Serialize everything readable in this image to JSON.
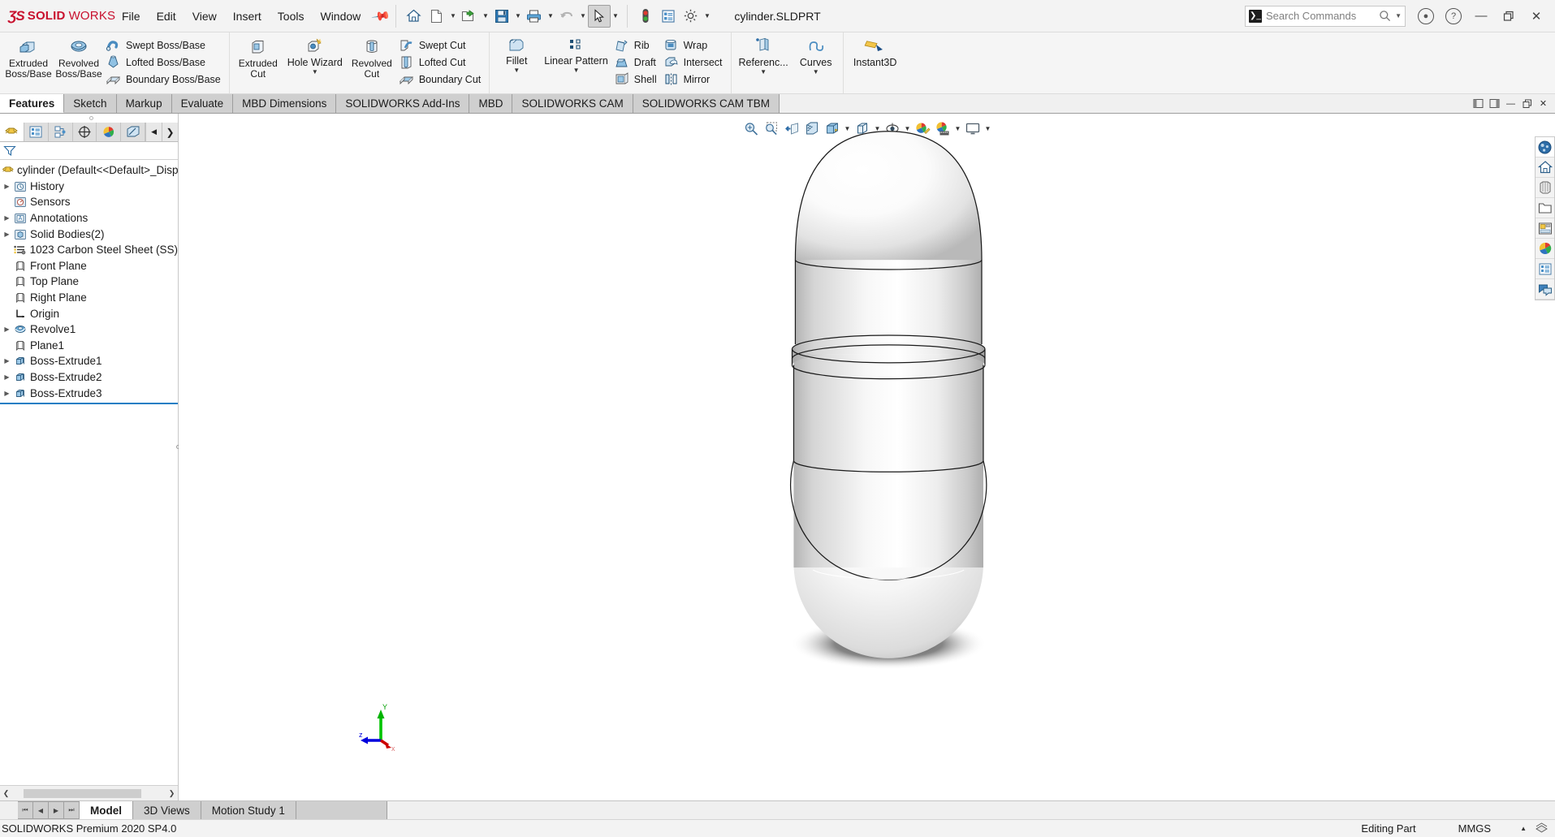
{
  "app": {
    "brand_ds": "ƷS",
    "brand_solid": "SOLID",
    "brand_works": "WORKS",
    "document_title": "cylinder.SLDPRT",
    "accent_red": "#c8102e",
    "accent_blue": "#1f7ec4"
  },
  "menu": {
    "items": [
      {
        "label": "File"
      },
      {
        "label": "Edit"
      },
      {
        "label": "View"
      },
      {
        "label": "Insert"
      },
      {
        "label": "Tools"
      },
      {
        "label": "Window"
      }
    ],
    "pin_icon": "pushpin-icon"
  },
  "quick_access": {
    "buttons": [
      {
        "icon": "home-icon",
        "has_caret": false
      },
      {
        "icon": "new-document-icon",
        "has_caret": true
      },
      {
        "icon": "open-folder-icon",
        "has_caret": true
      },
      {
        "icon": "save-icon",
        "has_caret": true
      },
      {
        "icon": "print-icon",
        "has_caret": true
      },
      {
        "icon": "undo-icon",
        "has_caret": true
      },
      {
        "icon": "select-cursor-icon",
        "has_caret": true
      },
      {
        "icon": "rebuild-traffic-light-icon",
        "has_caret": false
      },
      {
        "icon": "file-properties-icon",
        "has_caret": false
      },
      {
        "icon": "options-gear-icon",
        "has_caret": true
      }
    ]
  },
  "search": {
    "placeholder": "Search Commands",
    "icon": "search-commands-icon",
    "magnifier": "search-icon",
    "caret": "chevron-down-icon"
  },
  "window_controls": {
    "account": "account-icon",
    "help": "help-icon",
    "minimize": "minimize-icon",
    "restore": "restore-icon",
    "close": "close-icon"
  },
  "ribbon": {
    "groups": [
      {
        "name": "boss-base",
        "big": [
          {
            "label": "Extruded\nBoss/Base",
            "icon": "extruded-boss-base-icon",
            "caret": true
          },
          {
            "label": "Revolved\nBoss/Base",
            "icon": "revolved-boss-base-icon",
            "caret": true
          }
        ],
        "small": [
          {
            "label": "Swept Boss/Base",
            "icon": "swept-boss-base-icon"
          },
          {
            "label": "Lofted Boss/Base",
            "icon": "lofted-boss-base-icon"
          },
          {
            "label": "Boundary Boss/Base",
            "icon": "boundary-boss-base-icon"
          }
        ]
      },
      {
        "name": "cut",
        "big": [
          {
            "label": "Extruded\nCut",
            "icon": "extruded-cut-icon",
            "caret": true
          },
          {
            "label": "Hole Wizard",
            "icon": "hole-wizard-icon",
            "caret": true
          },
          {
            "label": "Revolved\nCut",
            "icon": "revolved-cut-icon",
            "caret": false
          }
        ],
        "small": [
          {
            "label": "Swept Cut",
            "icon": "swept-cut-icon"
          },
          {
            "label": "Lofted Cut",
            "icon": "lofted-cut-icon"
          },
          {
            "label": "Boundary Cut",
            "icon": "boundary-cut-icon"
          }
        ]
      },
      {
        "name": "features",
        "big": [
          {
            "label": "Fillet",
            "icon": "fillet-icon",
            "caret": true
          },
          {
            "label": "Linear Pattern",
            "icon": "linear-pattern-icon",
            "caret": true
          }
        ],
        "small": [
          {
            "label": "Rib",
            "icon": "rib-icon"
          },
          {
            "label": "Draft",
            "icon": "draft-icon"
          },
          {
            "label": "Shell",
            "icon": "shell-icon"
          }
        ],
        "small2": [
          {
            "label": "Wrap",
            "icon": "wrap-icon"
          },
          {
            "label": "Intersect",
            "icon": "intersect-icon"
          },
          {
            "label": "Mirror",
            "icon": "mirror-icon"
          }
        ]
      },
      {
        "name": "reference",
        "big": [
          {
            "label": "Referenc...",
            "icon": "reference-geometry-icon",
            "caret": true
          },
          {
            "label": "Curves",
            "icon": "curves-icon",
            "caret": true
          }
        ]
      },
      {
        "name": "instant3d",
        "big": [
          {
            "label": "Instant3D",
            "icon": "instant3d-icon",
            "caret": false
          }
        ]
      }
    ]
  },
  "command_tabs": {
    "items": [
      {
        "label": "Features",
        "active": true
      },
      {
        "label": "Sketch",
        "active": false
      },
      {
        "label": "Markup",
        "active": false
      },
      {
        "label": "Evaluate",
        "active": false
      },
      {
        "label": "MBD Dimensions",
        "active": false
      },
      {
        "label": "SOLIDWORKS Add-Ins",
        "active": false
      },
      {
        "label": "MBD",
        "active": false
      },
      {
        "label": "SOLIDWORKS CAM",
        "active": false
      },
      {
        "label": "SOLIDWORKS CAM TBM",
        "active": false
      }
    ],
    "right_buttons": [
      {
        "icon": "pin-panel-left-icon"
      },
      {
        "icon": "pin-panel-right-icon"
      },
      {
        "icon": "minimize-icon"
      },
      {
        "icon": "restore-icon"
      },
      {
        "icon": "close-icon"
      }
    ]
  },
  "feature_manager": {
    "tabs": [
      {
        "icon": "feature-tree-icon",
        "active": true
      },
      {
        "icon": "property-manager-icon",
        "active": false
      },
      {
        "icon": "configuration-manager-icon",
        "active": false
      },
      {
        "icon": "dimxpert-manager-icon",
        "active": false
      },
      {
        "icon": "display-manager-icon",
        "active": false
      },
      {
        "icon": "cam-manager-icon",
        "active": false
      }
    ],
    "collapse_arrow": "chevron-left-icon",
    "expand_arrow": "chevron-right-icon",
    "filter": {
      "icon": "filter-funnel-icon",
      "placeholder": ""
    },
    "tree": [
      {
        "label": "cylinder  (Default<<Default>_Display",
        "icon": "part-icon",
        "arrow": false,
        "indent": 0,
        "root": true
      },
      {
        "label": "History",
        "icon": "history-icon",
        "arrow": true,
        "indent": 1
      },
      {
        "label": "Sensors",
        "icon": "sensors-icon",
        "arrow": false,
        "indent": 1
      },
      {
        "label": "Annotations",
        "icon": "annotations-icon",
        "arrow": true,
        "indent": 1
      },
      {
        "label": "Solid Bodies(2)",
        "icon": "solid-bodies-icon",
        "arrow": true,
        "indent": 1
      },
      {
        "label": "1023 Carbon Steel Sheet (SS)",
        "icon": "material-icon",
        "arrow": false,
        "indent": 1
      },
      {
        "label": "Front Plane",
        "icon": "plane-icon",
        "arrow": false,
        "indent": 1
      },
      {
        "label": "Top Plane",
        "icon": "plane-icon",
        "arrow": false,
        "indent": 1
      },
      {
        "label": "Right Plane",
        "icon": "plane-icon",
        "arrow": false,
        "indent": 1
      },
      {
        "label": "Origin",
        "icon": "origin-icon",
        "arrow": false,
        "indent": 1
      },
      {
        "label": "Revolve1",
        "icon": "revolve-feature-icon",
        "arrow": true,
        "indent": 1
      },
      {
        "label": "Plane1",
        "icon": "plane-icon",
        "arrow": false,
        "indent": 1
      },
      {
        "label": "Boss-Extrude1",
        "icon": "boss-extrude-icon",
        "arrow": true,
        "indent": 1
      },
      {
        "label": "Boss-Extrude2",
        "icon": "boss-extrude-icon",
        "arrow": true,
        "indent": 1
      },
      {
        "label": "Boss-Extrude3",
        "icon": "boss-extrude-icon",
        "arrow": true,
        "indent": 1
      }
    ],
    "hscroll": {
      "left_arrow": "chevron-left-icon",
      "right_arrow": "chevron-right-icon"
    }
  },
  "heads_up_view": {
    "buttons": [
      {
        "icon": "zoom-to-fit-icon",
        "caret": false
      },
      {
        "icon": "zoom-to-area-icon",
        "caret": false
      },
      {
        "icon": "previous-view-icon",
        "caret": false
      },
      {
        "icon": "section-view-icon",
        "caret": false
      },
      {
        "icon": "view-orientation-icon",
        "caret": false
      },
      {
        "icon": "display-style-icon",
        "caret": true
      },
      {
        "icon": "hide-show-items-icon",
        "caret": true
      },
      {
        "icon": "edit-appearance-icon",
        "caret": true
      },
      {
        "icon": "apply-scene-icon",
        "caret": true
      },
      {
        "icon": "view-settings-icon",
        "caret": true
      }
    ]
  },
  "right_dock": {
    "buttons": [
      {
        "icon": "solidworks-resources-icon",
        "active": true
      },
      {
        "icon": "design-library-home-icon",
        "active": false
      },
      {
        "icon": "file-explorer-icon",
        "active": false
      },
      {
        "icon": "open-folder-icon",
        "active": false
      },
      {
        "icon": "view-palette-icon",
        "active": false
      },
      {
        "icon": "appearances-scenes-icon",
        "active": false
      },
      {
        "icon": "custom-properties-icon",
        "active": false
      },
      {
        "icon": "markup-comment-icon",
        "active": false
      }
    ]
  },
  "triad": {
    "x_label": "x",
    "y_label": "Y",
    "z_label": "z",
    "x_color": "#cc0000",
    "y_color": "#00b300",
    "z_color": "#0000dd"
  },
  "bottom_tabs": {
    "nav_buttons": [
      {
        "icon": "first-icon"
      },
      {
        "icon": "previous-icon"
      },
      {
        "icon": "next-icon"
      },
      {
        "icon": "last-icon"
      }
    ],
    "items": [
      {
        "label": "Model",
        "active": true
      },
      {
        "label": "3D Views",
        "active": false
      },
      {
        "label": "Motion Study 1",
        "active": false
      }
    ]
  },
  "status_bar": {
    "version": "SOLIDWORKS Premium 2020 SP4.0",
    "mode": "Editing Part",
    "units": "MMGS",
    "units_caret": "chevron-up-icon",
    "overlay_icon": "layers-icon"
  },
  "model": {
    "name": "cylinder capsule body",
    "shadow": true
  }
}
